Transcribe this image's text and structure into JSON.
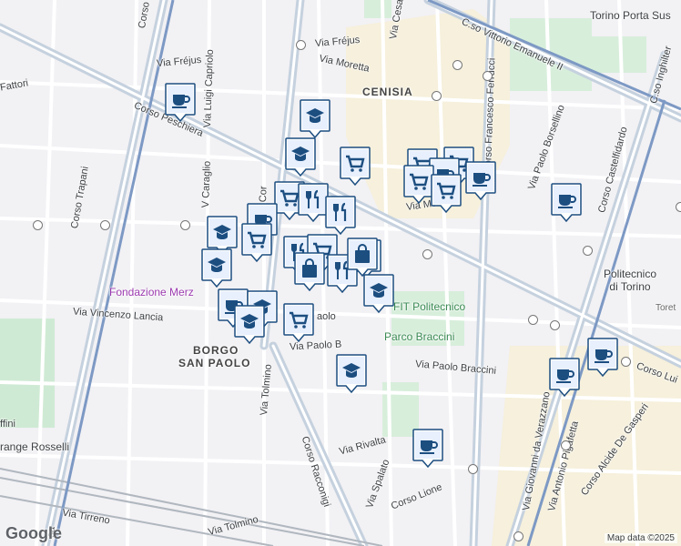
{
  "map": {
    "attribution": "Map data ©2025",
    "logo_text": "Google"
  },
  "labels": {
    "cenisia": "CENISIA",
    "borgo_1": "BORGO",
    "borgo_2": "SAN PAOLO",
    "torino_porta_susa": "Torino Porta Sus",
    "c_so_vittorio": "C.so Vittorio Emanuele II",
    "via_frejus_1": "Via Fréjus",
    "via_frejus_2": "Via Fréjus",
    "via_moretta": "Via Moretta",
    "corso_peschiera": "Corso Peschiera",
    "corso_trapani_top": "Corso Trapani",
    "corso_trapani": "Corso Trapani",
    "via_luigi_capriolo": "Via Luigi Capriolo",
    "v_caraglio": "V Caraglio",
    "via_fattori": "Fattori",
    "corso_ferrucci": "Corso Francesco Ferrucci",
    "via_paolo_borsellino": "Via Paolo Borsellino",
    "corso_castelfidardo": "Corso Castelfidardo",
    "c_so_inghilterra": "C.so Inghilter",
    "via_monginevro": "Via Mo  evro",
    "politecnico": "Politecnico\ndi Torino",
    "toret": "Toret",
    "fondazione_merz": "Fondazione Merz",
    "via_vincenzo_lancia": "Via Vincenzo Lancia",
    "fit_politecnico": "FIT Politecnico",
    "parco_braccini": "Parco Braccini",
    "via_paolo_braccini_1": "Via Paolo B",
    "via_paolo_braccini_2": "Via Paolo Braccini",
    "via_paolo_short": "aolo",
    "via_tolmino": "Via Tolmino",
    "via_tolmino_2": "Via Tolmino",
    "via_rivalta": "Via Rivalta",
    "via_spalato": "Via Spalato",
    "corso_racconigi": "Corso Racconigi",
    "corso_lione": "Corso Lione",
    "via_tirreno": "Via Tirreno",
    "grange_rosselli": "range Rosselli",
    "ffini": "ffini",
    "via_verazzano": "Via Giovanni da Verazzano",
    "via_pigafetta": "Via Antonio Pigafetta",
    "corso_de_gasperi": "Corso Alcide De Gasperi",
    "corso_lui": "Corso Lui",
    "via_cesana": "Via Cesar",
    "corso_r": "Cor",
    "via_sa": "sa"
  },
  "markers": [
    {
      "type": "cafe-icon"
    },
    {
      "type": "school-icon"
    },
    {
      "type": "school-icon"
    },
    {
      "type": "cart-icon"
    },
    {
      "type": "cart-icon"
    },
    {
      "type": "cart-icon"
    },
    {
      "type": "cafe-icon"
    },
    {
      "type": "cafe-icon"
    },
    {
      "type": "cart-icon"
    },
    {
      "type": "cart-icon"
    },
    {
      "type": "cart-icon"
    },
    {
      "type": "restaurant-icon"
    },
    {
      "type": "restaurant-icon"
    },
    {
      "type": "cafe-icon"
    },
    {
      "type": "school-icon"
    },
    {
      "type": "cart-icon"
    },
    {
      "type": "school-icon"
    },
    {
      "type": "restaurant-icon"
    },
    {
      "type": "cart-icon"
    },
    {
      "type": "cart-icon"
    },
    {
      "type": "shopping-bag-icon"
    },
    {
      "type": "restaurant-icon"
    },
    {
      "type": "shopping-bag-icon"
    },
    {
      "type": "school-icon"
    },
    {
      "type": "cafe-icon"
    },
    {
      "type": "school-icon"
    },
    {
      "type": "school-icon"
    },
    {
      "type": "cart-icon"
    },
    {
      "type": "school-icon"
    },
    {
      "type": "cafe-icon"
    },
    {
      "type": "cafe-icon"
    },
    {
      "type": "cafe-icon"
    },
    {
      "type": "cafe-icon"
    }
  ],
  "colors": {
    "marker_fill": "#1c4e80",
    "marker_bg": "#e8f0fe",
    "park": "#cdebd3",
    "road": "#ffffff",
    "major_road": "#b9c6d6",
    "highlight_area": "#f7eed6"
  }
}
